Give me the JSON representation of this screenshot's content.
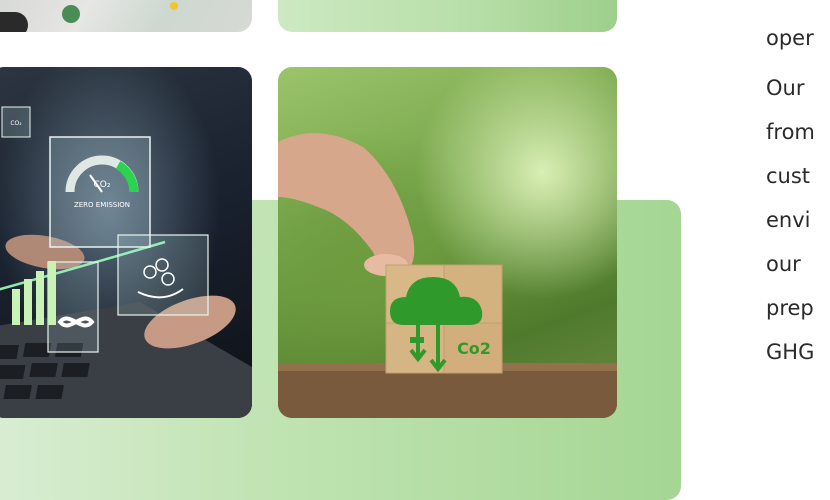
{
  "photos": {
    "laptop": {
      "hologram_co2": "CO₂",
      "hologram_zero": "ZERO EMISSION",
      "hologram_mini_co2": "CO₂"
    },
    "plant": {
      "block_label": "Co2"
    }
  },
  "text_column": {
    "lines": [
      "oper",
      "Our",
      "from",
      "cust",
      "envi",
      "our",
      "prep",
      "GHG"
    ]
  },
  "colors": {
    "backdrop_green": "#a5d694",
    "text": "#2b2b2b",
    "cloud_green": "#2f9a2b"
  }
}
